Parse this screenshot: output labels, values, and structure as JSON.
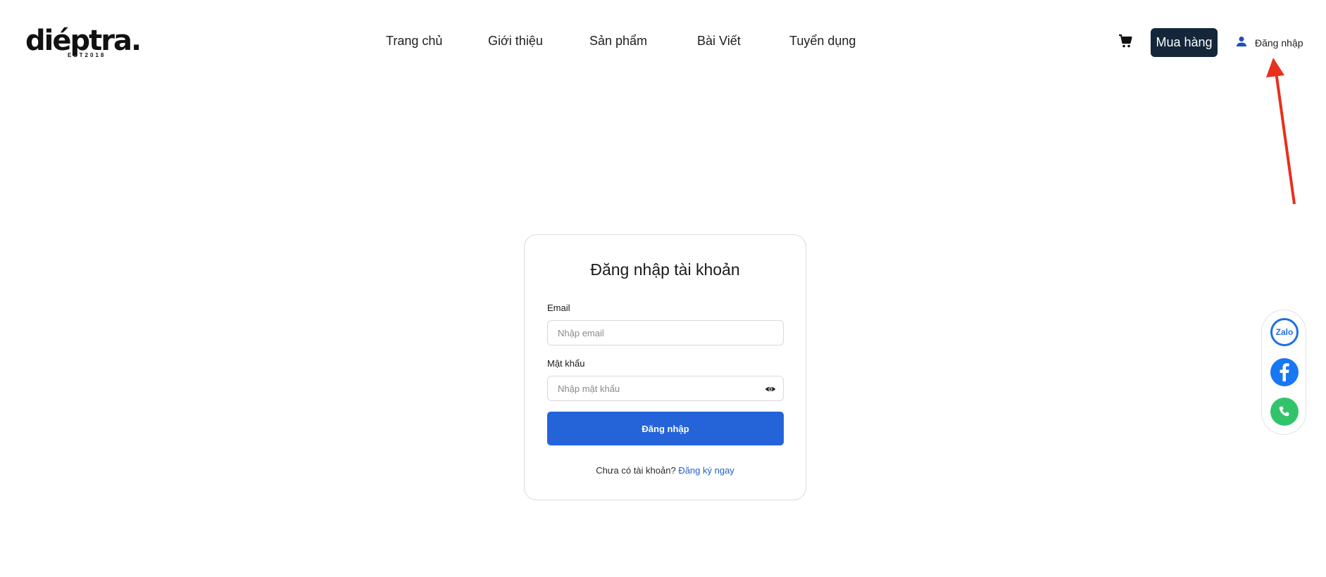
{
  "header": {
    "logo_text": "diéptra.",
    "logo_subtext": "EST2018",
    "nav": [
      {
        "label": "Trang chủ"
      },
      {
        "label": "Giới thiệu"
      },
      {
        "label": "Sản phẩm"
      },
      {
        "label": "Bài Viết"
      },
      {
        "label": "Tuyển dụng"
      }
    ],
    "cart_icon": "cart-icon",
    "buy_button": "Mua hàng",
    "login_label": "Đăng nhập",
    "login_icon": "user-icon"
  },
  "login_form": {
    "title": "Đăng nhập tài khoản",
    "email_label": "Email",
    "email_placeholder": "Nhập email",
    "password_label": "Mật khẩu",
    "password_placeholder": "Nhập mật khẩu",
    "submit_label": "Đăng nhập",
    "register_prompt": "Chưa có tài khoản?",
    "register_link": "Đăng ký ngay"
  },
  "social": {
    "zalo_text": "Zalo",
    "icons": [
      "zalo-icon",
      "facebook-icon",
      "phone-icon"
    ]
  },
  "colors": {
    "primary": "#2563d9",
    "buy_button_bg": "#13263a",
    "annotation_arrow": "#e8301c"
  }
}
